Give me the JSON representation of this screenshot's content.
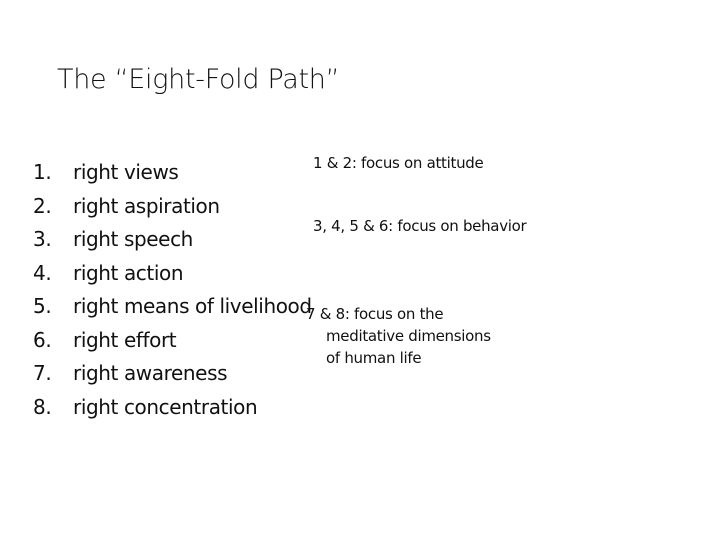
{
  "slide": {
    "title": "The “Eight-Fold Path”",
    "items": [
      {
        "number": "1.",
        "text": "right views"
      },
      {
        "number": "2.",
        "text": "right aspiration"
      },
      {
        "number": "3.",
        "text": "right speech"
      },
      {
        "number": "4.",
        "text": "right action"
      },
      {
        "number": "5.",
        "text": "right means of livelihood"
      },
      {
        "number": "6.",
        "text": "right effort"
      },
      {
        "number": "7.",
        "text": "right awareness"
      },
      {
        "number": "8.",
        "text": "right concentration"
      }
    ],
    "notes": {
      "attitude": "1 & 2: focus on attitude",
      "behavior": "3, 4, 5 & 6: focus on behavior",
      "meditative_line1": "7 & 8: focus on the",
      "meditative_line2": "meditative dimensions",
      "meditative_line3": "of human life"
    }
  }
}
